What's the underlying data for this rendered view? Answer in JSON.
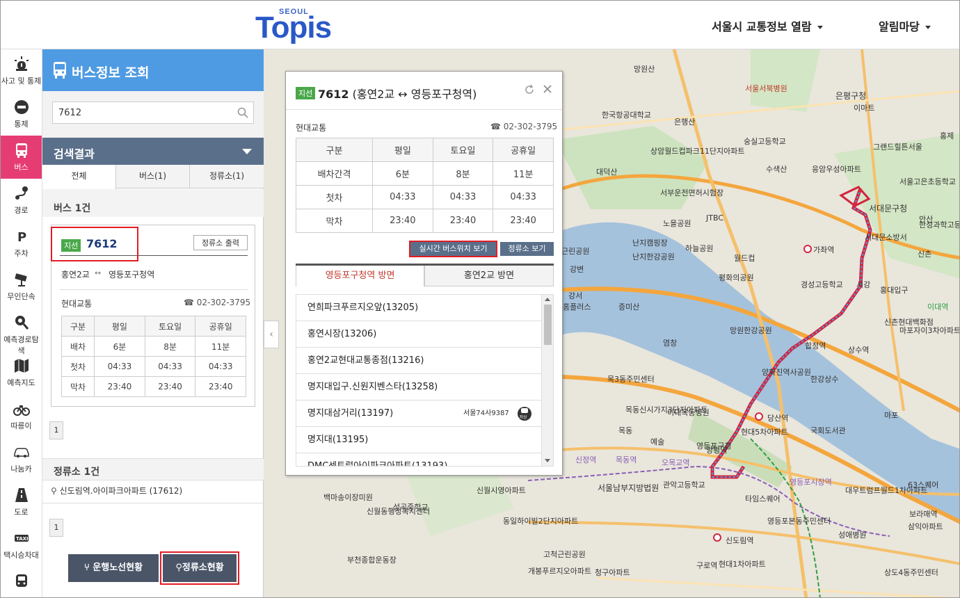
{
  "header": {
    "logo_small": "SEOUL",
    "logo_main": "Topis",
    "nav": [
      {
        "label": "서울시 교통정보 열람"
      },
      {
        "label": "알림마당"
      }
    ]
  },
  "iconbar": [
    {
      "label": "사고 및 통제",
      "icon": "alert-light-icon"
    },
    {
      "label": "통제",
      "icon": "no-entry-icon"
    },
    {
      "label": "버스",
      "icon": "bus-icon",
      "active": true
    },
    {
      "label": "경로",
      "icon": "route-icon"
    },
    {
      "label": "주차",
      "icon": "parking-icon"
    },
    {
      "label": "무인단속",
      "icon": "cctv-icon"
    },
    {
      "label": "예측경로탐색",
      "icon": "search-route-icon"
    },
    {
      "label": "예측지도",
      "icon": "map-icon"
    },
    {
      "label": "따릉이",
      "icon": "bicycle-icon"
    },
    {
      "label": "나눔카",
      "icon": "car-icon"
    },
    {
      "label": "도로",
      "icon": "road-icon"
    },
    {
      "label": "택시승차대",
      "icon": "taxi-icon",
      "badge": "TAXI"
    },
    {
      "label": "",
      "icon": "train-icon"
    }
  ],
  "panel": {
    "title": "버스정보 조회",
    "search": {
      "value": "7612",
      "placeholder": ""
    },
    "results_title": "검색결과",
    "tabs": [
      {
        "label": "전체",
        "active": true
      },
      {
        "label": "버스(1)"
      },
      {
        "label": "정류소(1)"
      }
    ],
    "bus_section_title": "버스 1건",
    "bus_card": {
      "badge": "지선",
      "number": "7612",
      "print_label": "정류소 출력",
      "from": "홍연2교",
      "to": "영등포구청역",
      "company": "현대교통",
      "phone": "02-302-3795",
      "table": {
        "headers": [
          "구분",
          "평일",
          "토요일",
          "공휴일"
        ],
        "rows": [
          [
            "배차",
            "6분",
            "8분",
            "11분"
          ],
          [
            "첫차",
            "04:33",
            "04:33",
            "04:33"
          ],
          [
            "막차",
            "23:40",
            "23:40",
            "23:40"
          ]
        ]
      }
    },
    "bus_page": "1",
    "stop_section_title": "정류소 1건",
    "stop_item": "신도림역.아이파크아파트 (17612)",
    "stop_page": "1",
    "buttons": {
      "route_status": "운행노선현황",
      "stop_status": "정류소현황"
    }
  },
  "popup": {
    "badge": "지선",
    "number": "7612",
    "title_rest": "(홍연2교 ↔ 영등포구청역)",
    "company": "현대교통",
    "phone": "02-302-3795",
    "table": {
      "headers": [
        "구분",
        "평일",
        "토요일",
        "공휴일"
      ],
      "rows": [
        [
          "배차간격",
          "6분",
          "8분",
          "11분"
        ],
        [
          "첫차",
          "04:33",
          "04:33",
          "04:33"
        ],
        [
          "막차",
          "23:40",
          "23:40",
          "23:40"
        ]
      ]
    },
    "live_button": "실시간 버스위치 보기",
    "stops_button": "정류소 보기",
    "direction_tabs": [
      {
        "label": "영등포구청역 방면",
        "active": true
      },
      {
        "label": "홍연2교 방면"
      }
    ],
    "stops": [
      {
        "name": "연희파크푸르지오앞(13205)"
      },
      {
        "name": "홍연시장(13206)"
      },
      {
        "name": "홍연2교현대교통종점(13216)"
      },
      {
        "name": "명지대입구.신원지벤스타(13258)"
      },
      {
        "name": "명지대삼거리(13197)",
        "vehicle": "서울74사9387",
        "vehicle_type": "저상"
      },
      {
        "name": "명지대(13195)"
      },
      {
        "name": "DMC센트럴아이파크아파트(13193)"
      }
    ]
  },
  "map_labels": [
    "망원산",
    "서울서북병원",
    "은평구청",
    "이마트",
    "한국항공대학교",
    "은행산",
    "숭실고등학교",
    "그랜드힐튼서울",
    "상암월드컵파크11단지아파트",
    "수색산",
    "응암우성아파트",
    "서울고은초등학교",
    "대덕산",
    "서부운전면허시험장",
    "노을공원",
    "JTBC",
    "서대문구청",
    "서대문소방서",
    "안산",
    "한성과학고등학교",
    "가좌역",
    "난지캠핑장",
    "하늘공원",
    "난지한강공원",
    "월드컵",
    "평화의공원",
    "경성고등학교",
    "증미산",
    "이대역",
    "망원한강공원",
    "신촌현대백화점",
    "마포자이3차아파트",
    "목3동주민센터",
    "양화진역사공원",
    "한강상수",
    "이대목동병원",
    "당산역",
    "목동신시가지3단지아파트",
    "국회도서관",
    "현대5차아파트",
    "서울남부지방법원",
    "관악고등학교",
    "대우트럼프월드1차아파트",
    "63스퀘어",
    "보라매역",
    "타임스퀘어",
    "영등포본동주민센터",
    "신도림역",
    "성애병원",
    "삼익아파트",
    "구로역",
    "현대1차아파트",
    "성곡중학교",
    "신월시영아파트",
    "동일하이빌2단지아파트",
    "신월동행정복지센터",
    "부천종합운동장",
    "개봉푸르지오아파트",
    "고척근린공원",
    "청구아파트",
    "상도4동주민센터",
    "백마송이장미원",
    "신정역",
    "목동역",
    "오목교역",
    "영등포시장역",
    "영등포구청",
    "양평역",
    "마포",
    "서강",
    "신촌",
    "홍제",
    "합정역",
    "상수역",
    "강서",
    "홍대입구",
    "홈플러스",
    "근린공원",
    "강변",
    "염창",
    "예술",
    "목동"
  ]
}
